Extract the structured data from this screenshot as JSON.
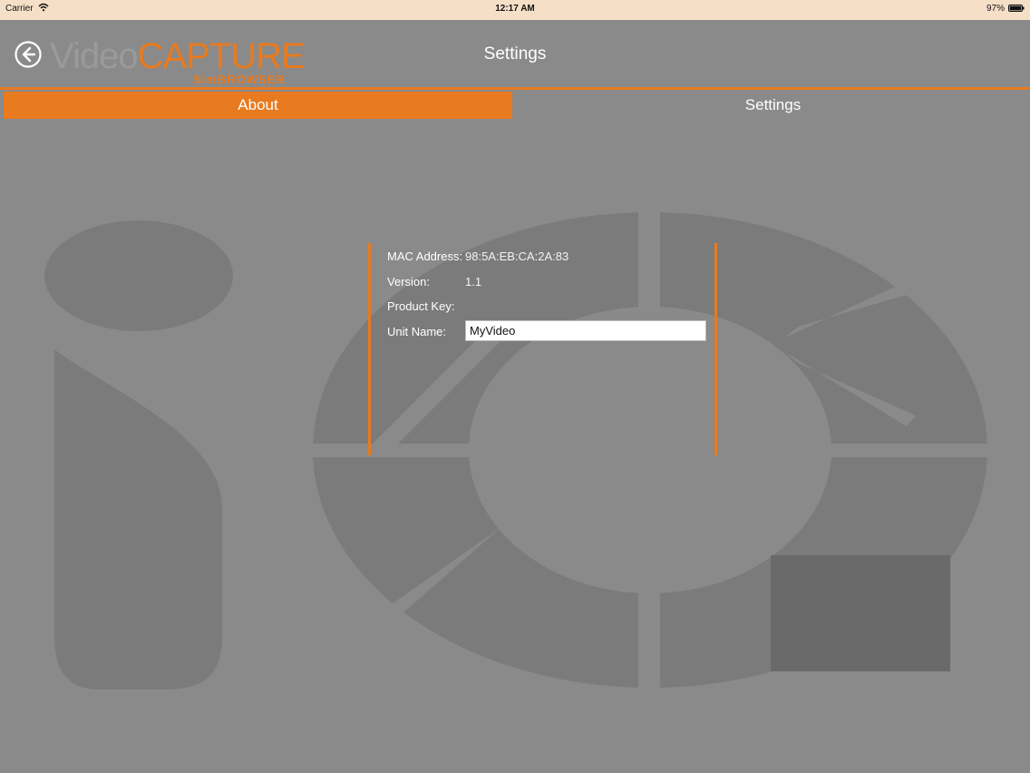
{
  "status_bar": {
    "carrier": "Carrier",
    "time": "12:17 AM",
    "battery_percent": "97%"
  },
  "header": {
    "logo_text_light": "Video",
    "logo_text_accent": "CAPTURE",
    "logo_subtitle": "SimBROWSER",
    "title": "Settings"
  },
  "tabs": [
    {
      "label": "About",
      "active": true
    },
    {
      "label": "Settings",
      "active": false
    }
  ],
  "about": {
    "mac_address_label": "MAC Address:",
    "mac_address_value": "98:5A:EB:CA:2A:83",
    "version_label": "Version:",
    "version_value": "1.1",
    "product_key_label": "Product Key:",
    "product_key_value": "",
    "unit_name_label": "Unit Name:",
    "unit_name_value": "MyVideo"
  },
  "colors": {
    "accent": "#e87a1f",
    "background": "#8a8a8a",
    "status_bar": "#f5dfc6"
  }
}
